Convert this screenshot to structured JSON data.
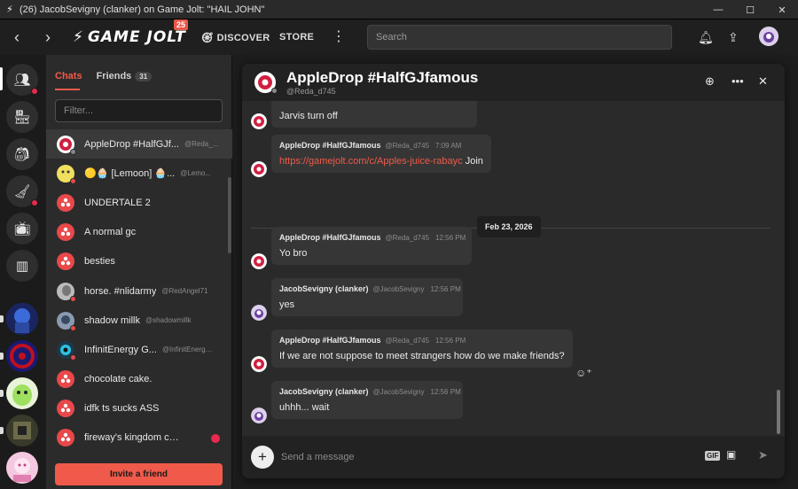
{
  "window": {
    "title": "(26) JacobSevigny (clanker) on Game Jolt: \"HAIL JOHN\"",
    "minimize": "—",
    "maximize": "☐",
    "close": "✕"
  },
  "nav": {
    "back": "‹",
    "forward": "›",
    "logo": "GAME JOLT",
    "logo_badge": "25",
    "discover": "DISCOVER",
    "store": "STORE",
    "more": "⋮",
    "search_placeholder": "Search"
  },
  "chatlist": {
    "tab_chats": "Chats",
    "tab_friends": "Friends",
    "friends_count": "31",
    "filter_placeholder": "Filter...",
    "invite_label": "Invite a friend",
    "items": [
      {
        "name": "AppleDrop #HalfGJf...",
        "handle": "@Reda_..."
      },
      {
        "name": "🟡🧁 [Lemoon] 🧁...",
        "handle": "@Lemo..."
      },
      {
        "name": "UNDERTALE 2",
        "handle": ""
      },
      {
        "name": "A normal gc",
        "handle": ""
      },
      {
        "name": "besties",
        "handle": ""
      },
      {
        "name": "horse. #nlidarmy",
        "handle": "@RedAngel71"
      },
      {
        "name": "shadow millk",
        "handle": "@shadowmillk"
      },
      {
        "name": "InfinitEnergy G...",
        "handle": "@InfinitEnergy-..."
      },
      {
        "name": "chocolate cake.",
        "handle": ""
      },
      {
        "name": "idfk ts sucks ASS",
        "handle": ""
      },
      {
        "name": "fireway's kingdom cum ...",
        "handle": ""
      }
    ]
  },
  "chat": {
    "title": "AppleDrop #HalfGJfamous",
    "handle": "@Reda_d745",
    "date_separator": "Feb 23, 2026",
    "composer_placeholder": "Send a message",
    "gif_label": "GIF",
    "messages": [
      {
        "author": "",
        "handle": "",
        "time": "",
        "text": "Jarvis turn off"
      },
      {
        "author": "AppleDrop #HalfGJfamous",
        "handle": "@Reda_d745",
        "time": "7:09 AM",
        "link": "https://gamejolt.com/c/Apples-juice-rabayc",
        "text": "Join"
      },
      {
        "author": "AppleDrop #HalfGJfamous",
        "handle": "@Reda_d745",
        "time": "12:56 PM",
        "text": "Yo bro"
      },
      {
        "author": "JacobSevigny (clanker)",
        "handle": "@JacobSevigny",
        "time": "12:56 PM",
        "text": "yes"
      },
      {
        "author": "AppleDrop #HalfGJfamous",
        "handle": "@Reda_d745",
        "time": "12:56 PM",
        "text": "If we are not suppose to meet strangers how do we make friends?"
      },
      {
        "author": "JacobSevigny (clanker)",
        "handle": "@JacobSevigny",
        "time": "12:56 PM",
        "text": "uhhh... wait"
      }
    ]
  }
}
